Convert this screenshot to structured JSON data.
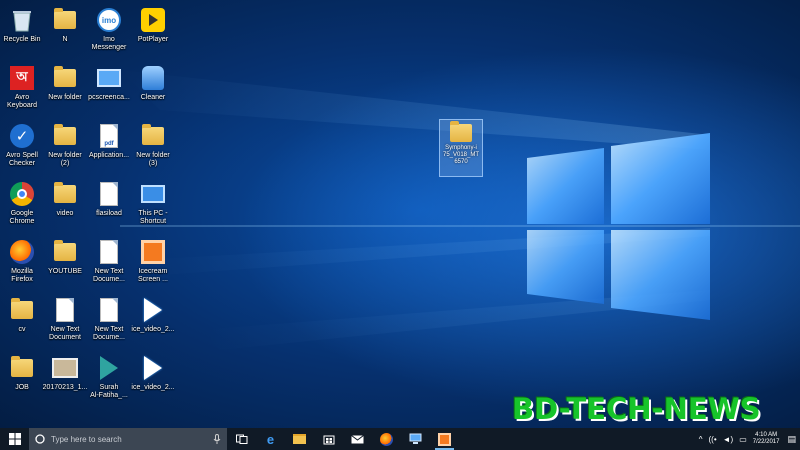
{
  "desktop": {
    "icons": [
      {
        "label": "Recycle Bin",
        "icon": "recycle-bin-icon"
      },
      {
        "label": "N",
        "icon": "folder-icon"
      },
      {
        "label": "Imo\nMessenger",
        "icon": "imo-icon"
      },
      {
        "label": "PotPlayer",
        "icon": "potplayer-icon"
      },
      {
        "label": "Avro\nKeyboard",
        "icon": "avro-keyboard-icon"
      },
      {
        "label": "New folder",
        "icon": "folder-icon"
      },
      {
        "label": "pcscreenca...",
        "icon": "shortcut-icon"
      },
      {
        "label": "Cleaner",
        "icon": "cleaner-icon"
      },
      {
        "label": "Avro Spell\nChecker",
        "icon": "spell-checker-icon"
      },
      {
        "label": "New folder\n(2)",
        "icon": "folder-icon"
      },
      {
        "label": "Application...",
        "icon": "pdf-icon"
      },
      {
        "label": "New folder\n(3)",
        "icon": "folder-icon"
      },
      {
        "label": "Google\nChrome",
        "icon": "chrome-icon"
      },
      {
        "label": "video",
        "icon": "folder-icon"
      },
      {
        "label": "flasiload",
        "icon": "document-icon"
      },
      {
        "label": "This PC -\nShortcut",
        "icon": "this-pc-icon"
      },
      {
        "label": "Mozilla\nFirefox",
        "icon": "firefox-icon"
      },
      {
        "label": "YOUTUBE",
        "icon": "folder-icon"
      },
      {
        "label": "New Text\nDocume...",
        "icon": "document-icon"
      },
      {
        "label": "Icecream\nScreen ...",
        "icon": "icecream-icon"
      },
      {
        "label": "cv",
        "icon": "folder-icon"
      },
      {
        "label": "New Text\nDocument",
        "icon": "document-icon"
      },
      {
        "label": "New Text\nDocume...",
        "icon": "document-icon"
      },
      {
        "label": "ice_video_2...",
        "icon": "video-file-icon"
      },
      {
        "label": "JOB",
        "icon": "folder-icon"
      },
      {
        "label": "20170213_1...",
        "icon": "image-file-icon"
      },
      {
        "label": "Surah\nAl-Fatiha_...",
        "icon": "mp3-file-icon"
      },
      {
        "label": "ice_video_2...",
        "icon": "video-file-icon"
      }
    ],
    "selected_file": {
      "label": "Symphony-i\n75_V018_MT\n6570",
      "icon": "folder-icon"
    }
  },
  "watermark": "BD-TECH-NEWS",
  "taskbar": {
    "search_placeholder": "Type here to search",
    "pinned": [
      "edge-icon",
      "file-explorer-icon",
      "store-icon",
      "mail-icon",
      "firefox-icon",
      "remote-icon",
      "icecream-recorder-icon"
    ],
    "clock_time": "4:10 AM",
    "clock_date": "7/22/2017"
  },
  "colors": {
    "watermark_green": "#17c42a",
    "taskbar": "#101a26",
    "search_box": "#3c4653"
  }
}
